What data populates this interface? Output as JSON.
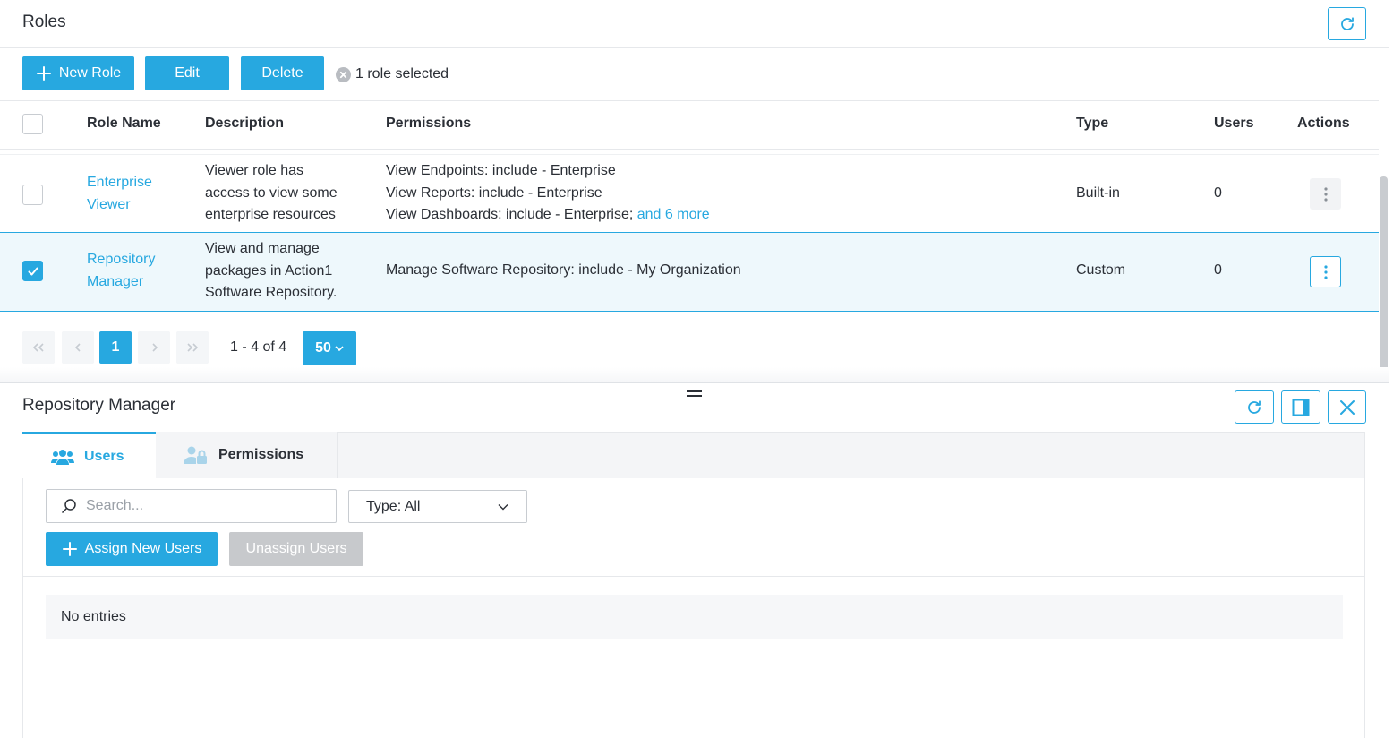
{
  "header": {
    "title": "Roles"
  },
  "toolbar": {
    "new_role_label": "New Role",
    "edit_label": "Edit",
    "delete_label": "Delete",
    "selection_text": "1 role selected"
  },
  "table": {
    "columns": [
      "Role Name",
      "Description",
      "Permissions",
      "Type",
      "Users",
      "Actions"
    ],
    "rows": [
      {
        "name_line1": "Enterprise",
        "name_line2": "Viewer",
        "desc_lines": [
          "Viewer role has",
          "access to view some",
          "enterprise resources"
        ],
        "perm_lines": [
          "View Endpoints: include - Enterprise",
          "View Reports: include - Enterprise",
          "View Dashboards: include - Enterprise;"
        ],
        "perm_more": "and 6 more",
        "type": "Built-in",
        "users": "0",
        "checked": false
      },
      {
        "name_line1": "Repository",
        "name_line2": "Manager",
        "desc_lines": [
          "View and manage",
          "packages in Action1",
          "Software Repository."
        ],
        "perm_lines": [
          "Manage Software Repository: include - My Organization"
        ],
        "type": "Custom",
        "users": "0",
        "checked": true
      }
    ]
  },
  "pagination": {
    "current_page": "1",
    "range_text": "1 - 4 of 4",
    "page_size": "50"
  },
  "details": {
    "title": "Repository Manager",
    "tabs": [
      {
        "label": "Users",
        "icon": "users-icon",
        "active": true
      },
      {
        "label": "Permissions",
        "icon": "user-lock-icon",
        "active": false
      }
    ],
    "search": {
      "placeholder": "Search..."
    },
    "type_filter": {
      "value": "Type: All"
    },
    "assign_label": "Assign New Users",
    "unassign_label": "Unassign Users",
    "empty_text": "No entries"
  },
  "colors": {
    "accent": "#27a8e0",
    "selected_row_bg": "#eef8fc",
    "disabled_button": "#c7c9cc"
  }
}
